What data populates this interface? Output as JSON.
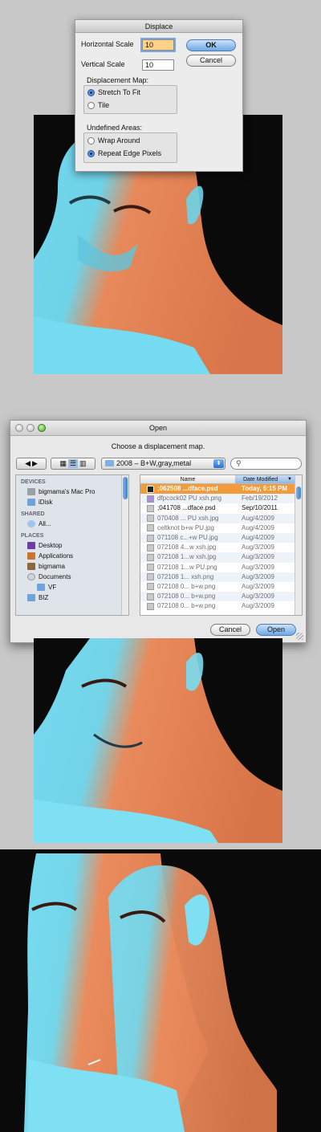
{
  "displace_dialog": {
    "title": "Displace",
    "horizontal_scale_label": "Horizontal Scale",
    "horizontal_scale_value": "10",
    "vertical_scale_label": "Vertical Scale",
    "vertical_scale_value": "10",
    "ok_label": "OK",
    "cancel_label": "Cancel",
    "displacement_map_label": "Displacement Map:",
    "stretch_to_fit_label": "Stretch To Fit",
    "tile_label": "Tile",
    "undefined_areas_label": "Undefined Areas:",
    "wrap_around_label": "Wrap Around",
    "repeat_edge_pixels_label": "Repeat Edge Pixels",
    "selected_map_option": "Stretch To Fit",
    "selected_undefined_option": "Repeat Edge Pixels"
  },
  "open_dialog": {
    "title": "Open",
    "prompt": "Choose a displacement map.",
    "path_popup": "2008 –  B+W,gray,metal",
    "search_placeholder": "",
    "sidebar": {
      "devices_header": "DEVICES",
      "devices": [
        "bigmama's Mac Pro",
        "iDisk"
      ],
      "shared_header": "SHARED",
      "shared": [
        "All..."
      ],
      "places_header": "PLACES",
      "places": [
        "Desktop",
        "Applications",
        "bigmama",
        "Documents",
        "VF",
        "BIZ"
      ]
    },
    "columns": {
      "name": "Name",
      "date": "Date Modified"
    },
    "files": [
      {
        "name": ";062508 ...dface.psd",
        "date": "Today, 5:15 PM"
      },
      {
        "name": "dfpcock02 PU xsh.png",
        "date": "Feb/19/2012"
      },
      {
        "name": ";041708 ...dface.psd",
        "date": "Sep/10/2011"
      },
      {
        "name": "070408 ... PU xsh.jpg",
        "date": "Aug/4/2009"
      },
      {
        "name": "celtknot b+w PU.jpg",
        "date": "Aug/4/2009"
      },
      {
        "name": "071108 c...+w PU.jpg",
        "date": "Aug/4/2009"
      },
      {
        "name": "072108 4...w xsh.jpg",
        "date": "Aug/3/2009"
      },
      {
        "name": "072108 1...w xsh.jpg",
        "date": "Aug/3/2009"
      },
      {
        "name": "072108 1...w PU.png",
        "date": "Aug/3/2009"
      },
      {
        "name": "072108 1... xsh.png",
        "date": "Aug/3/2009"
      },
      {
        "name": "072108 0... b+w.png",
        "date": "Aug/3/2009"
      },
      {
        "name": "072108 0... b+w.png",
        "date": "Aug/3/2009"
      },
      {
        "name": "072108 0... b+w.png",
        "date": "Aug/3/2009"
      }
    ],
    "cancel_label": "Cancel",
    "open_label": "Open"
  },
  "colors": {
    "skin_orange": "#e98a5c",
    "skin_cyan": "#6fd4ea",
    "selection_orange": "#f39a3a",
    "background": "#0a0a0a"
  }
}
